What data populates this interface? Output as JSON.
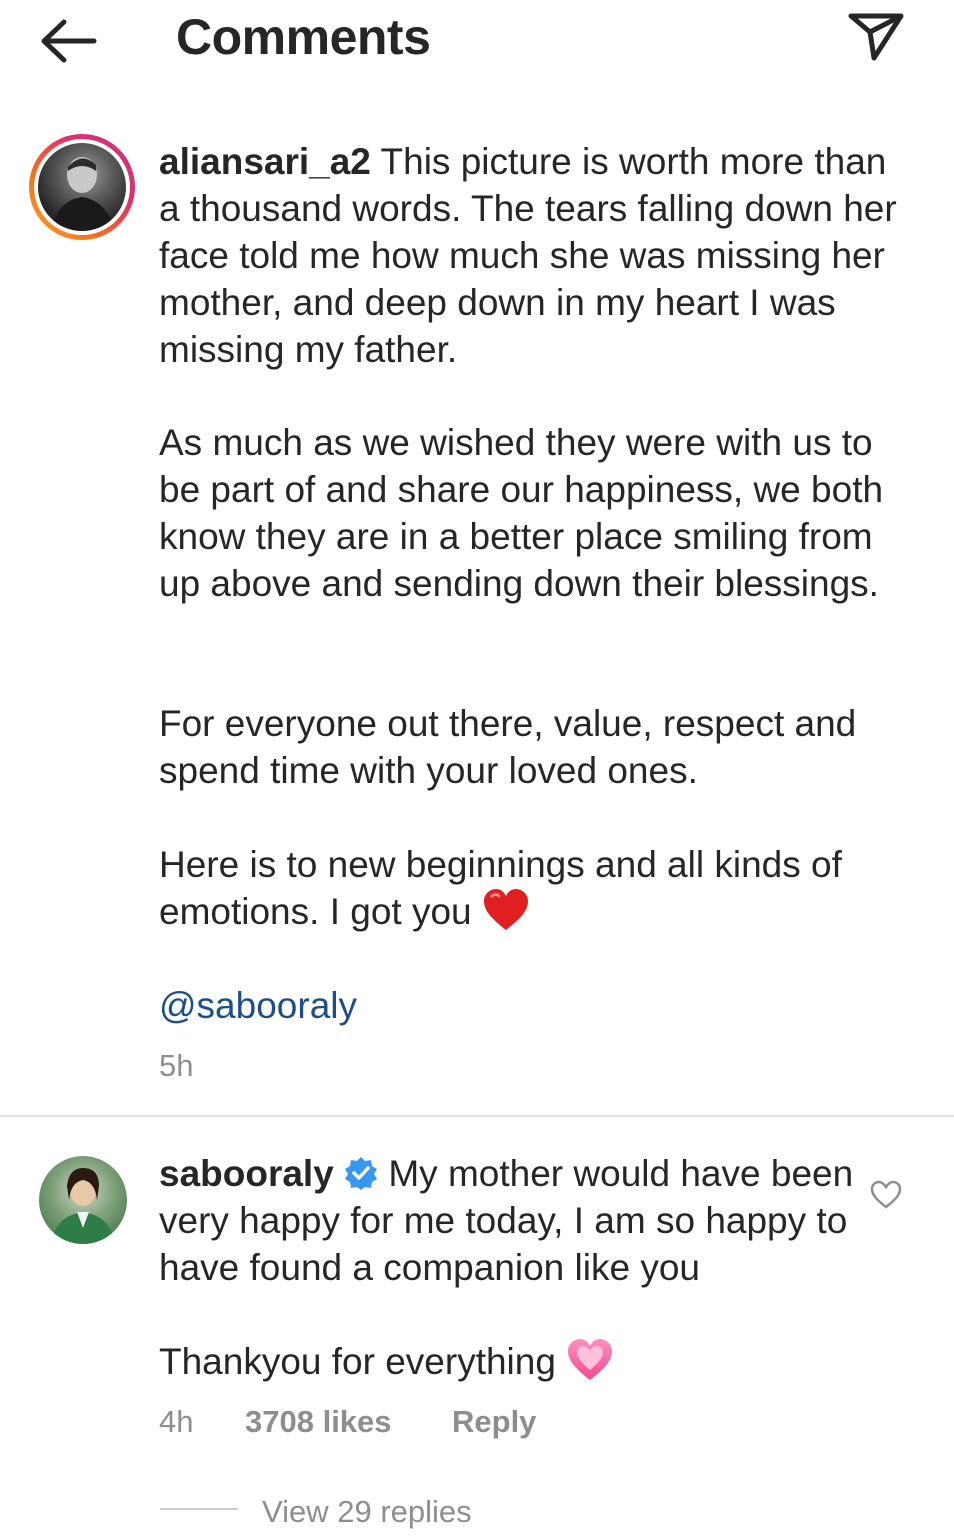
{
  "header": {
    "title": "Comments",
    "back_icon": "arrow-left-icon",
    "send_icon": "paper-plane-icon"
  },
  "comments": [
    {
      "username": "aliansari_a2",
      "paragraphs": [
        "This picture is worth more than a thousand words. The tears falling down her face told me how much she was missing her mother, and deep down in my heart I was missing my father.",
        "As much as we wished they were with us to be part of and share our happiness, we both know they are in a better place smiling from up above and sending down their blessings.",
        "For everyone out there, value, respect and spend time with your loved ones.",
        "Here is to new beginnings and all kinds of emotions. I got you"
      ],
      "emoji": "red-heart",
      "mention": "@sabooraly",
      "time": "5h"
    },
    {
      "username": "sabooraly",
      "verified": true,
      "text_line1": "My mother would have been very happy for me today, I am so happy to have found a companion like you",
      "text_line2": "Thankyou for everything",
      "emoji": "pink-heart",
      "time": "4h",
      "likes": "3708 likes",
      "reply": "Reply",
      "view_replies": "View 29 replies"
    }
  ],
  "colors": {
    "mention": "#1d4e89",
    "verified": "#3897f0",
    "meta": "#8e8e8e"
  }
}
